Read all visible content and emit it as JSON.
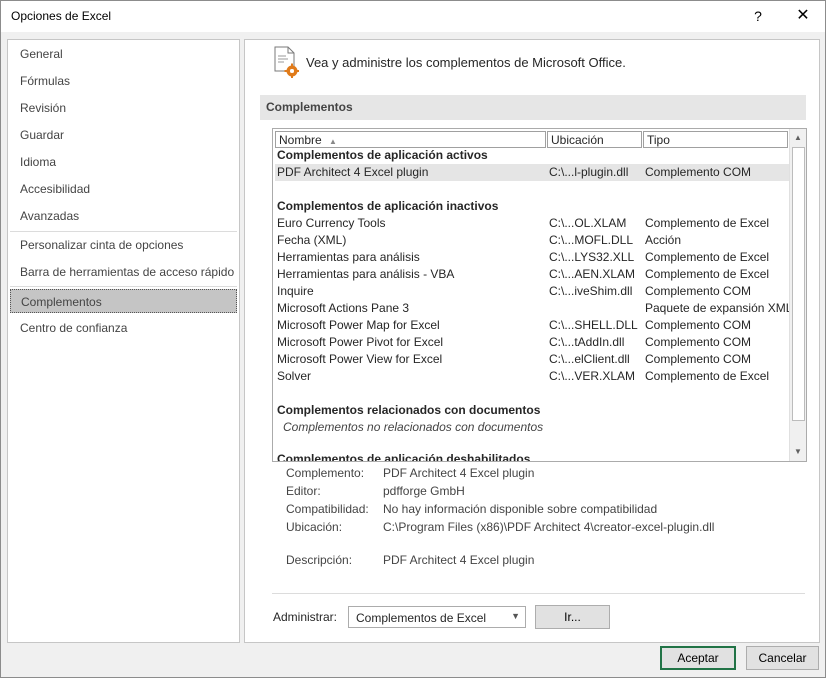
{
  "window": {
    "title": "Opciones de Excel",
    "help": "?",
    "close": "✕"
  },
  "nav": {
    "items": [
      "General",
      "Fórmulas",
      "Revisión",
      "Guardar",
      "Idioma",
      "Accesibilidad",
      "Avanzadas",
      "Personalizar cinta de opciones",
      "Barra de herramientas de acceso rápido",
      "Complementos",
      "Centro de confianza"
    ],
    "selected": "Complementos"
  },
  "header": {
    "text": "Vea y administre los complementos de Microsoft Office.",
    "icon": "addins-gear-icon"
  },
  "section": {
    "title": "Complementos"
  },
  "list": {
    "columns": {
      "name": "Nombre",
      "location": "Ubicación",
      "type": "Tipo",
      "sort_icon": "▲"
    },
    "groups": {
      "active": "Complementos de aplicación activos",
      "inactive": "Complementos de aplicación inactivos",
      "documents": "Complementos relacionados con documentos",
      "documents_note": "Complementos no relacionados con documentos",
      "disabled": "Complementos de aplicación deshabilitados"
    },
    "active_rows": [
      {
        "name": "PDF Architect 4 Excel plugin",
        "location": "C:\\...l-plugin.dll",
        "type": "Complemento COM"
      }
    ],
    "inactive_rows": [
      {
        "name": "Euro Currency Tools",
        "location": "C:\\...OL.XLAM",
        "type": "Complemento de Excel"
      },
      {
        "name": "Fecha (XML)",
        "location": "C:\\...MOFL.DLL",
        "type": "Acción"
      },
      {
        "name": "Herramientas para análisis",
        "location": "C:\\...LYS32.XLL",
        "type": "Complemento de Excel"
      },
      {
        "name": "Herramientas para análisis - VBA",
        "location": "C:\\...AEN.XLAM",
        "type": "Complemento de Excel"
      },
      {
        "name": "Inquire",
        "location": "C:\\...iveShim.dll",
        "type": "Complemento COM"
      },
      {
        "name": "Microsoft Actions Pane 3",
        "location": "",
        "type": "Paquete de expansión XML"
      },
      {
        "name": "Microsoft Power Map for Excel",
        "location": "C:\\...SHELL.DLL",
        "type": "Complemento COM"
      },
      {
        "name": "Microsoft Power Pivot for Excel",
        "location": "C:\\...tAddIn.dll",
        "type": "Complemento COM"
      },
      {
        "name": "Microsoft Power View for Excel",
        "location": "C:\\...elClient.dll",
        "type": "Complemento COM"
      },
      {
        "name": "Solver",
        "location": "C:\\...VER.XLAM",
        "type": "Complemento de Excel"
      }
    ]
  },
  "details": {
    "complemento_label": "Complemento:",
    "complemento": "PDF Architect 4 Excel plugin",
    "editor_label": "Editor:",
    "editor": "pdfforge GmbH",
    "compat_label": "Compatibilidad:",
    "compat": "No hay información disponible sobre compatibilidad",
    "ubicacion_label": "Ubicación:",
    "ubicacion": "C:\\Program Files (x86)\\PDF Architect 4\\creator-excel-plugin.dll",
    "descripcion_label": "Descripción:",
    "descripcion": "PDF Architect 4 Excel plugin"
  },
  "manage": {
    "label": "Administrar:",
    "selected": "Complementos de Excel",
    "go_button": "Ir..."
  },
  "footer": {
    "ok": "Aceptar",
    "cancel": "Cancelar"
  },
  "colors": {
    "accent": "#217346",
    "selected_nav": "#c5c5c5"
  }
}
